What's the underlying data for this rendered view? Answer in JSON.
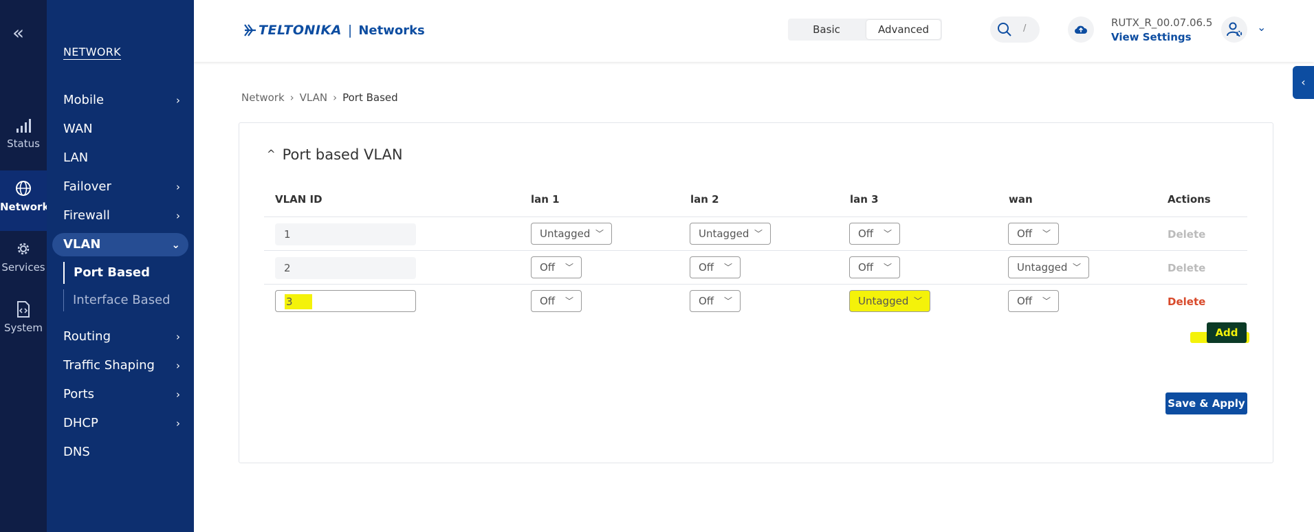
{
  "rail": {
    "collapse_icon": "double-chevron-left-icon",
    "items": [
      {
        "label": "Status",
        "icon": "signal-bars-icon"
      },
      {
        "label": "Network",
        "icon": "globe-icon"
      },
      {
        "label": "Services",
        "icon": "gear-icon"
      },
      {
        "label": "System",
        "icon": "file-code-icon"
      }
    ]
  },
  "sidebar": {
    "heading": "NETWORK",
    "items": [
      {
        "label": "Mobile",
        "has_children": true
      },
      {
        "label": "WAN"
      },
      {
        "label": "LAN"
      },
      {
        "label": "Failover",
        "has_children": true
      },
      {
        "label": "Firewall",
        "has_children": true
      },
      {
        "label": "VLAN",
        "has_children": true,
        "active": true
      },
      {
        "label": "Routing",
        "has_children": true
      },
      {
        "label": "Traffic Shaping",
        "has_children": true
      },
      {
        "label": "Ports",
        "has_children": true
      },
      {
        "label": "DHCP",
        "has_children": true
      },
      {
        "label": "DNS"
      }
    ],
    "vlan_sub": [
      {
        "label": "Port Based",
        "active": true
      },
      {
        "label": "Interface Based"
      }
    ]
  },
  "header": {
    "brand": "TELTONIKA",
    "separator": "|",
    "product": "Networks",
    "modes": [
      "Basic",
      "Advanced"
    ],
    "active_mode": "Advanced",
    "search_shortcut": "/",
    "firmware": "RUTX_R_00.07.06.5",
    "view_settings": "View Settings"
  },
  "breadcrumb": [
    "Network",
    "VLAN",
    "Port Based"
  ],
  "section": {
    "title": "Port based VLAN",
    "columns": [
      "VLAN ID",
      "lan 1",
      "lan 2",
      "lan 3",
      "wan",
      "Actions"
    ],
    "rows": [
      {
        "vlan_id": "1",
        "lan1": "Untagged",
        "lan2": "Untagged",
        "lan3": "Off",
        "wan": "Off",
        "action": "Delete"
      },
      {
        "vlan_id": "2",
        "lan1": "Off",
        "lan2": "Off",
        "lan3": "Off",
        "wan": "Untagged",
        "action": "Delete"
      },
      {
        "vlan_id": "3",
        "lan1": "Off",
        "lan2": "Off",
        "lan3": "Untagged",
        "wan": "Off",
        "action": "Delete"
      }
    ],
    "add_label": "Add",
    "save_label": "Save & Apply"
  },
  "colors": {
    "rail_bg": "#0f1e46",
    "sidebar_bg": "#0d2f6f",
    "brand_blue": "#0d4da1",
    "delete_red": "#d84a2b",
    "highlight_yellow": "#f4f20a"
  }
}
